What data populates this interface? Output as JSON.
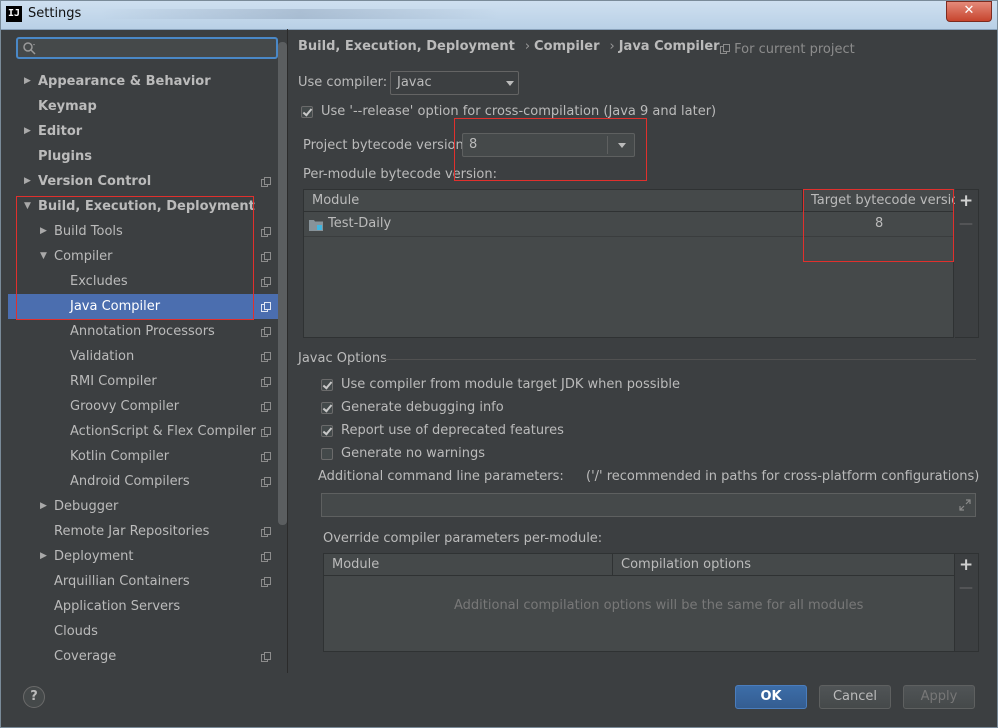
{
  "window": {
    "title": "Settings",
    "app_icon_text": "IJ"
  },
  "sidebar": {
    "search_placeholder": "",
    "items": [
      {
        "label": "Appearance & Behavior",
        "bold": true,
        "arrow": "▶",
        "level": 0,
        "copy": false
      },
      {
        "label": "Keymap",
        "bold": true,
        "arrow": "",
        "level": 0,
        "copy": false
      },
      {
        "label": "Editor",
        "bold": true,
        "arrow": "▶",
        "level": 0,
        "copy": false
      },
      {
        "label": "Plugins",
        "bold": true,
        "arrow": "",
        "level": 0,
        "copy": false
      },
      {
        "label": "Version Control",
        "bold": true,
        "arrow": "▶",
        "level": 0,
        "copy": true
      },
      {
        "label": "Build, Execution, Deployment",
        "bold": true,
        "arrow": "▼",
        "level": 0,
        "copy": false
      },
      {
        "label": "Build Tools",
        "bold": false,
        "arrow": "▶",
        "level": 1,
        "copy": true
      },
      {
        "label": "Compiler",
        "bold": false,
        "arrow": "▼",
        "level": 1,
        "copy": true
      },
      {
        "label": "Excludes",
        "bold": false,
        "arrow": "",
        "level": 2,
        "copy": true
      },
      {
        "label": "Java Compiler",
        "bold": false,
        "arrow": "",
        "level": 2,
        "copy": true,
        "selected": true
      },
      {
        "label": "Annotation Processors",
        "bold": false,
        "arrow": "",
        "level": 2,
        "copy": true
      },
      {
        "label": "Validation",
        "bold": false,
        "arrow": "",
        "level": 2,
        "copy": true
      },
      {
        "label": "RMI Compiler",
        "bold": false,
        "arrow": "",
        "level": 2,
        "copy": true
      },
      {
        "label": "Groovy Compiler",
        "bold": false,
        "arrow": "",
        "level": 2,
        "copy": true
      },
      {
        "label": "ActionScript & Flex Compiler",
        "bold": false,
        "arrow": "",
        "level": 2,
        "copy": true
      },
      {
        "label": "Kotlin Compiler",
        "bold": false,
        "arrow": "",
        "level": 2,
        "copy": true
      },
      {
        "label": "Android Compilers",
        "bold": false,
        "arrow": "",
        "level": 2,
        "copy": true
      },
      {
        "label": "Debugger",
        "bold": false,
        "arrow": "▶",
        "level": 1,
        "copy": false
      },
      {
        "label": "Remote Jar Repositories",
        "bold": false,
        "arrow": "",
        "level": 1,
        "copy": true
      },
      {
        "label": "Deployment",
        "bold": false,
        "arrow": "▶",
        "level": 1,
        "copy": true
      },
      {
        "label": "Arquillian Containers",
        "bold": false,
        "arrow": "",
        "level": 1,
        "copy": true
      },
      {
        "label": "Application Servers",
        "bold": false,
        "arrow": "",
        "level": 1,
        "copy": false
      },
      {
        "label": "Clouds",
        "bold": false,
        "arrow": "",
        "level": 1,
        "copy": false
      },
      {
        "label": "Coverage",
        "bold": false,
        "arrow": "",
        "level": 1,
        "copy": true
      }
    ]
  },
  "main": {
    "breadcrumb": [
      "Build, Execution, Deployment",
      "Compiler",
      "Java Compiler"
    ],
    "breadcrumb_sep": "›",
    "for_current_project": "For current project",
    "use_compiler_label": "Use compiler:",
    "use_compiler_value": "Javac",
    "release_option_label": "Use '--release' option for cross-compilation (Java 9 and later)",
    "release_option_checked": true,
    "project_bytecode_label": "Project bytecode version:",
    "project_bytecode_value": "8",
    "per_module_label": "Per-module bytecode version:",
    "module_table": {
      "columns": [
        "Module",
        "Target bytecode version"
      ],
      "rows": [
        {
          "module": "Test-Daily",
          "version": "8"
        }
      ]
    },
    "javac_options_title": "Javac Options",
    "javac_options": [
      {
        "label": "Use compiler from module target JDK when possible",
        "checked": true
      },
      {
        "label": "Generate debugging info",
        "checked": true
      },
      {
        "label": "Report use of deprecated features",
        "checked": true
      },
      {
        "label": "Generate no warnings",
        "checked": false
      }
    ],
    "additional_params_label": "Additional command line parameters:",
    "additional_params_hint": "('/' recommended in paths for cross-platform configurations)",
    "additional_params_value": "",
    "override_label": "Override compiler parameters per-module:",
    "override_table": {
      "columns": [
        "Module",
        "Compilation options"
      ],
      "empty_text": "Additional compilation options will be the same for all modules"
    },
    "plus": "+",
    "minus": "—"
  },
  "buttons": {
    "help": "?",
    "ok": "OK",
    "cancel": "Cancel",
    "apply": "Apply"
  }
}
